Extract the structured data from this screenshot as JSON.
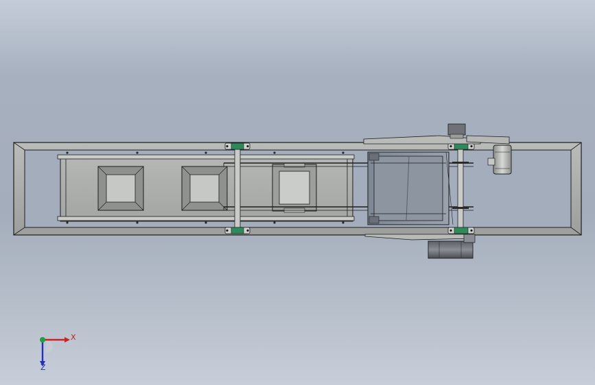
{
  "viewport": {
    "background": {
      "top": "#c4ccd8",
      "middle": "#a4adbb",
      "bottom": "#c7ced9"
    }
  },
  "model": {
    "description_kind": "conveyor assembly top view",
    "frame_color": "#a8aca8",
    "bearing_color": "#2e8a5a"
  },
  "triad": {
    "x_label": "X",
    "z_label": "Z",
    "x_color": "#d02020",
    "y_color": "#20a040",
    "z_color": "#2030c0"
  }
}
